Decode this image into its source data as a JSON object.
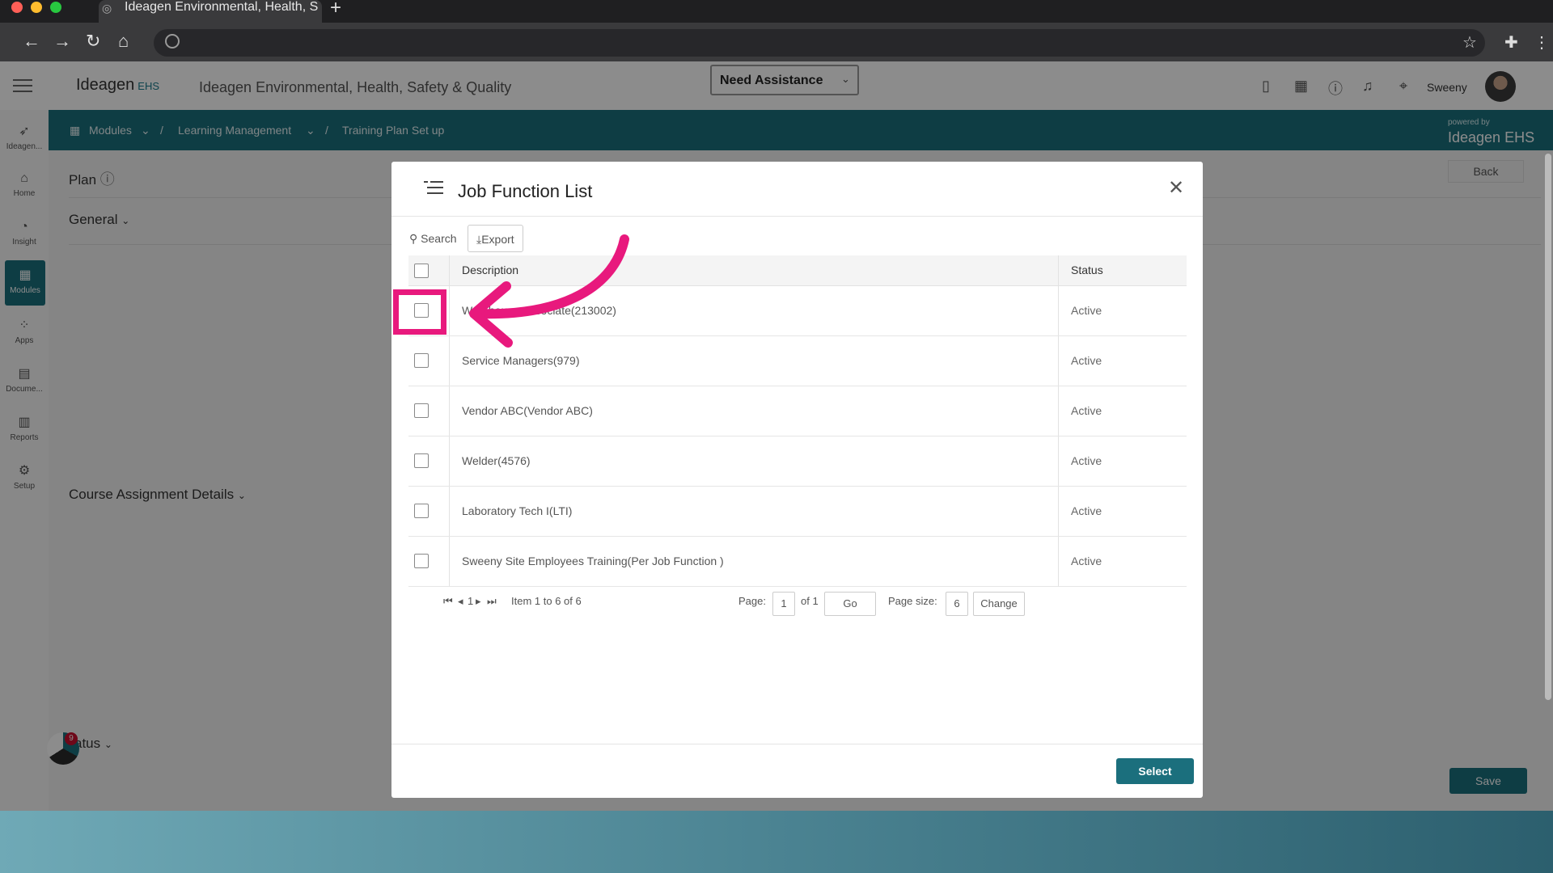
{
  "browser": {
    "tab_title": "Ideagen Environmental, Health, S",
    "new_tab": "+"
  },
  "header": {
    "logo_text": "Ideagen",
    "logo_suffix": "EHS",
    "app_title": "Ideagen Environmental, Health, Safety & Quality",
    "assist_label": "Need Assistance",
    "username": "Sweeny"
  },
  "breadcrumb": {
    "items": [
      "Modules",
      "Learning Management",
      "Training Plan Set up"
    ],
    "separator": "/",
    "powered_by": "powered by",
    "powered_logo": "Ideagen EHS"
  },
  "sidebar": {
    "items": [
      {
        "label": "Ideagen..."
      },
      {
        "label": "Home"
      },
      {
        "label": "Insight"
      },
      {
        "label": "Modules"
      },
      {
        "label": "Apps"
      },
      {
        "label": "Docume..."
      },
      {
        "label": "Reports"
      },
      {
        "label": "Setup"
      }
    ]
  },
  "page": {
    "plan_label": "Plan",
    "general_label": "General",
    "course_label": "Course Assignment Details",
    "status_label": "atus",
    "back_label": "Back",
    "save_label": "Save",
    "widget_badge": "9"
  },
  "modal": {
    "title": "Job Function List",
    "search_label": "Search",
    "export_label": "Export",
    "columns": {
      "description": "Description",
      "status": "Status"
    },
    "rows": [
      {
        "description": "Warehouse Associate(213002)",
        "status": "Active"
      },
      {
        "description": "Service Managers(979)",
        "status": "Active"
      },
      {
        "description": "Vendor ABC(Vendor ABC)",
        "status": "Active"
      },
      {
        "description": "Welder(4576)",
        "status": "Active"
      },
      {
        "description": "Laboratory Tech I(LTI)",
        "status": "Active"
      },
      {
        "description": "Sweeny Site Employees Training(Per Job Function )",
        "status": "Active"
      }
    ],
    "pager": {
      "current": "1",
      "summary": "Item 1 to 6 of 6",
      "page_label": "Page:",
      "page_value": "1",
      "of_label": "of 1",
      "go_label": "Go",
      "size_label": "Page size:",
      "size_value": "6",
      "change_label": "Change"
    },
    "select_label": "Select"
  },
  "colors": {
    "brand": "#1b6f7d",
    "annotation": "#e8197d"
  }
}
